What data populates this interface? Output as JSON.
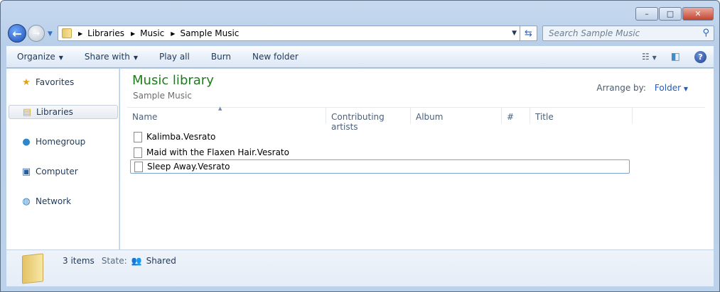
{
  "window": {
    "minimize": "–",
    "maximize": "□",
    "close": "✕"
  },
  "address": {
    "crumbs": [
      "Libraries",
      "Music",
      "Sample Music"
    ],
    "dropdown": "▼",
    "refresh": "⇆"
  },
  "search": {
    "placeholder": "Search Sample Music"
  },
  "toolbar": {
    "organize": "Organize",
    "share_with": "Share with",
    "play_all": "Play all",
    "burn": "Burn",
    "new_folder": "New folder"
  },
  "nav": [
    {
      "label": "Favorites",
      "icon": "★"
    },
    {
      "label": "Libraries",
      "icon": "▤"
    },
    {
      "label": "Homegroup",
      "icon": "●"
    },
    {
      "label": "Computer",
      "icon": "▣"
    },
    {
      "label": "Network",
      "icon": "◍"
    }
  ],
  "library": {
    "title": "Music library",
    "subtitle": "Sample Music",
    "arrange_label": "Arrange by:",
    "arrange_value": "Folder"
  },
  "columns": [
    "Name",
    "Contributing artists",
    "Album",
    "#",
    "Title"
  ],
  "files": [
    "Kalimba.Vesrato",
    "Maid with the Flaxen Hair.Vesrato",
    "Sleep Away.Vesrato"
  ],
  "details": {
    "count": "3 items",
    "state_label": "State:",
    "state_value": "Shared"
  }
}
